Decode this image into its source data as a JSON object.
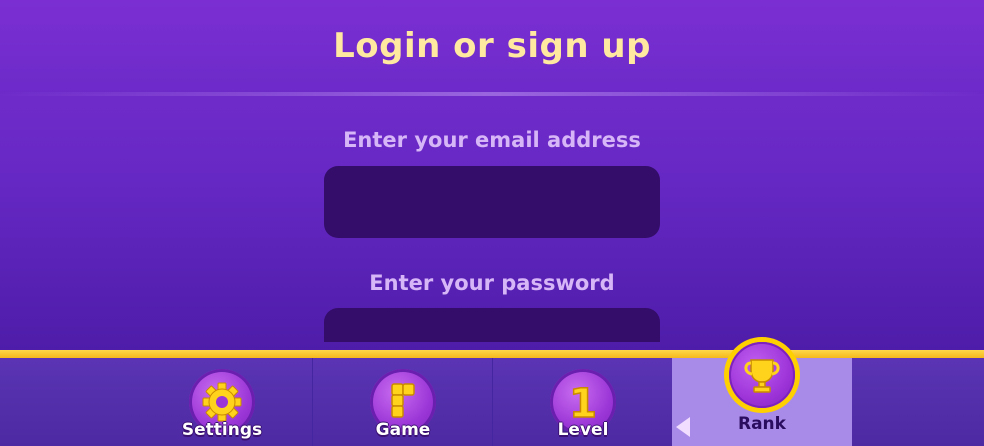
{
  "header": {
    "title": "Login or sign up"
  },
  "form": {
    "email_label": "Enter your email address",
    "email_value": "",
    "password_label": "Enter your password",
    "password_value": ""
  },
  "nav": {
    "items": [
      {
        "label": "Settings",
        "icon": "gear-icon"
      },
      {
        "label": "Game",
        "icon": "block-piece-icon"
      },
      {
        "label": "Level",
        "icon": "number-one-icon",
        "icon_text": "1"
      },
      {
        "label": "Rank",
        "icon": "trophy-icon",
        "active": true
      }
    ]
  },
  "colors": {
    "title": "#ffe9a0",
    "label": "#d7b6f7",
    "input_bg": "#340d6a",
    "accent_gold": "#ffd000",
    "active_tab": "#a88ae8"
  }
}
